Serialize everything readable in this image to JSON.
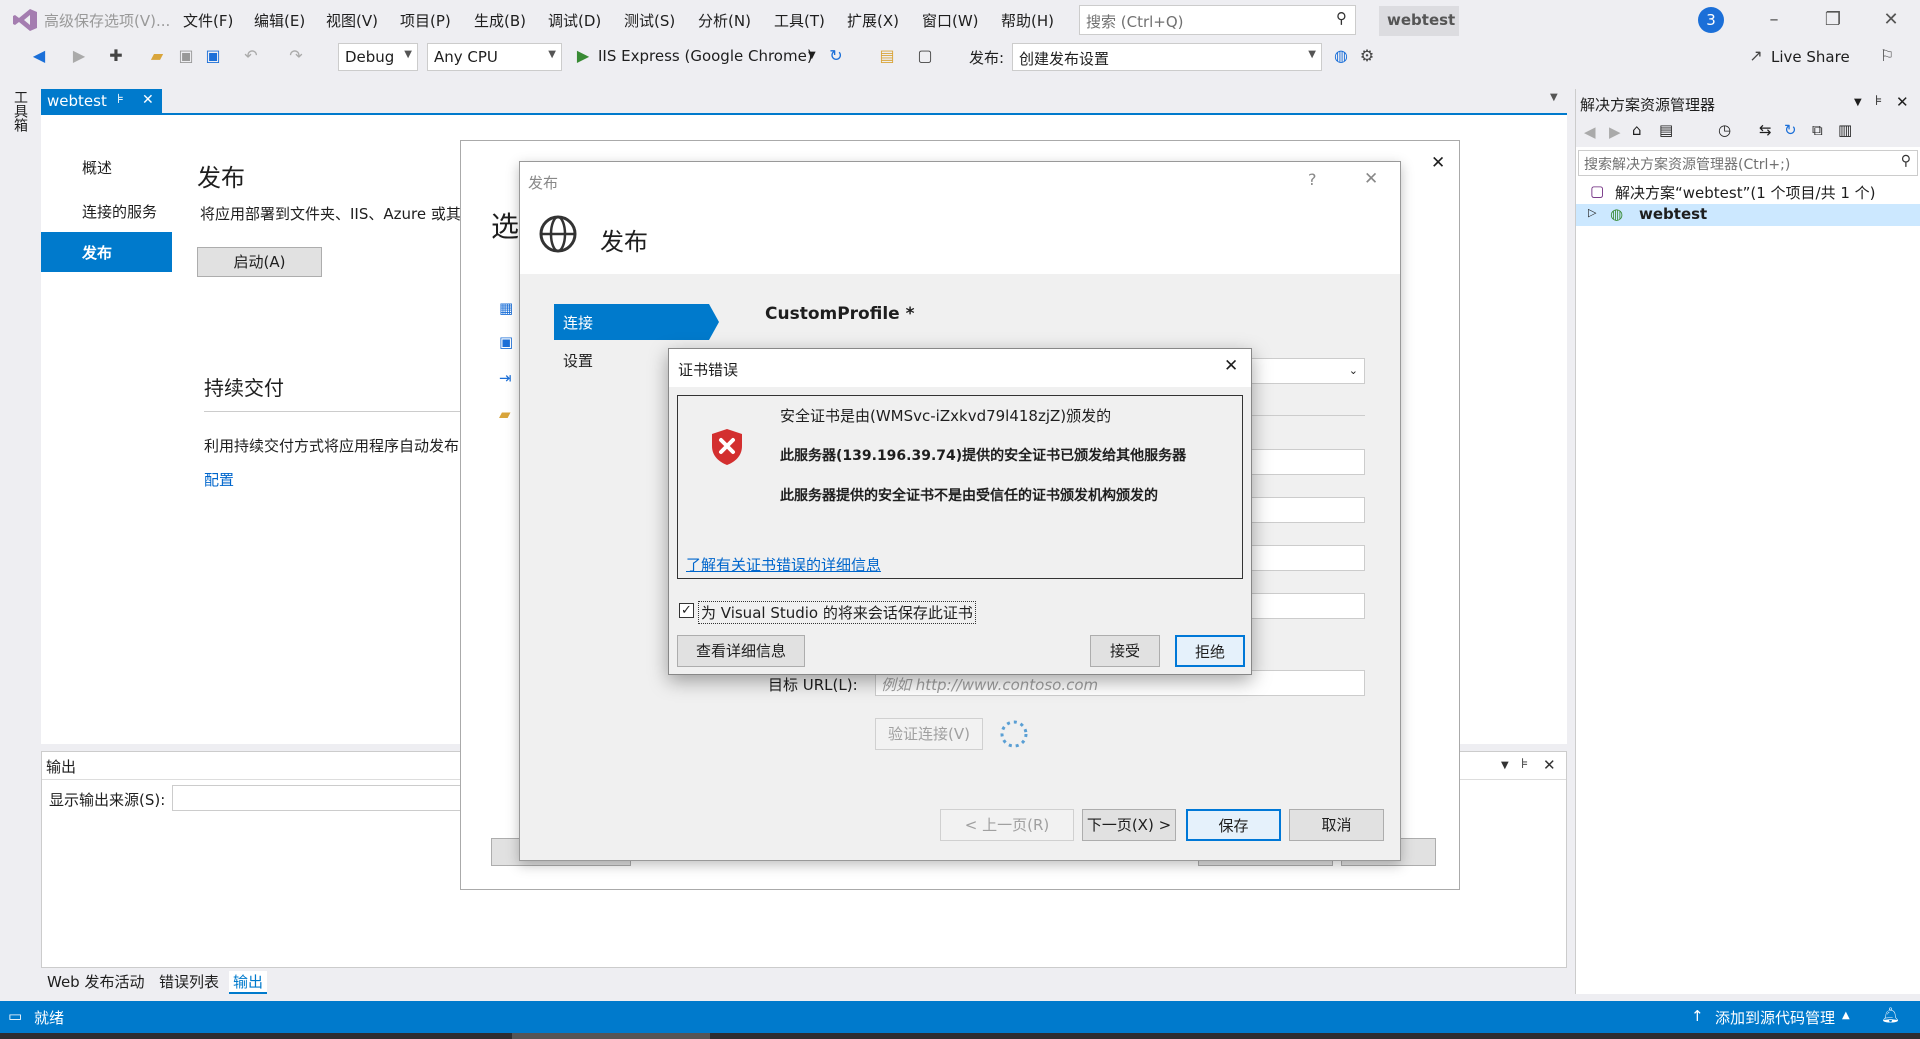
{
  "titlebar": {
    "app_title": "高级保存选项(V)...",
    "menu": [
      "文件(F)",
      "编辑(E)",
      "视图(V)",
      "项目(P)",
      "生成(B)",
      "调试(D)",
      "测试(S)",
      "分析(N)",
      "工具(T)",
      "扩展(X)",
      "窗口(W)",
      "帮助(H)"
    ],
    "search_placeholder": "搜索 (Ctrl+Q)",
    "solution_name": "webtest",
    "notifications": "3"
  },
  "toolbar": {
    "config": "Debug",
    "platform": "Any CPU",
    "run_target": "IIS Express (Google Chrome)",
    "publish_label": "发布:",
    "publish_value": "创建发布设置",
    "live_share": "Live Share"
  },
  "toolbox_label": "工具箱",
  "doc_tab": {
    "title": "webtest",
    "pin": "⊧",
    "close": "✕"
  },
  "publish_page": {
    "nav": [
      "概述",
      "连接的服务",
      "发布"
    ],
    "title": "发布",
    "desc": "将应用部署到文件夹、IIS、Azure 或其他",
    "start_button": "启动(A)",
    "cd_title": "持续交付",
    "cd_desc": "利用持续交付方式将应用程序自动发布",
    "cd_link": "配置",
    "partial_title": "选"
  },
  "output": {
    "title": "输出",
    "source_label": "显示输出来源(S):"
  },
  "bottom_tabs": [
    "Web 发布活动",
    "错误列表",
    "输出"
  ],
  "solution_explorer": {
    "title": "解决方案资源管理器",
    "search_placeholder": "搜索解决方案资源管理器(Ctrl+;)",
    "solution_item": "解决方案“webtest”(1 个项目/共 1 个)",
    "project_item": "webtest"
  },
  "statusbar": {
    "status": "就绪",
    "source_control": "添加到源代码管理"
  },
  "publish_dialog": {
    "title": "发布",
    "help": "?",
    "header": "发布",
    "nav": [
      "连接",
      "设置"
    ],
    "profile": "CustomProfile *",
    "target_url_label": "目标 URL(L):",
    "target_url_placeholder": "例如 http://www.contoso.com",
    "validate_button": "验证连接(V)",
    "prev_button": "< 上一页(R)",
    "next_button": "下一页(X) >",
    "save_button": "保存",
    "cancel_button": "取消"
  },
  "cert_dialog": {
    "title": "证书错误",
    "line1": "安全证书是由(WMSvc-iZxkvd79l418zjZ)颁发的",
    "line2": "此服务器(139.196.39.74)提供的安全证书已颁发给其他服务器",
    "line3": "此服务器提供的安全证书不是由受信任的证书颁发机构颁发的",
    "link": "了解有关证书错误的详细信息",
    "checkbox_label": "为 Visual Studio 的将来会话保存此证书",
    "checkbox_checked": true,
    "details_button": "查看详细信息",
    "accept_button": "接受",
    "reject_button": "拒绝"
  },
  "colors": {
    "accent": "#007acc",
    "error": "#d32f2f"
  }
}
